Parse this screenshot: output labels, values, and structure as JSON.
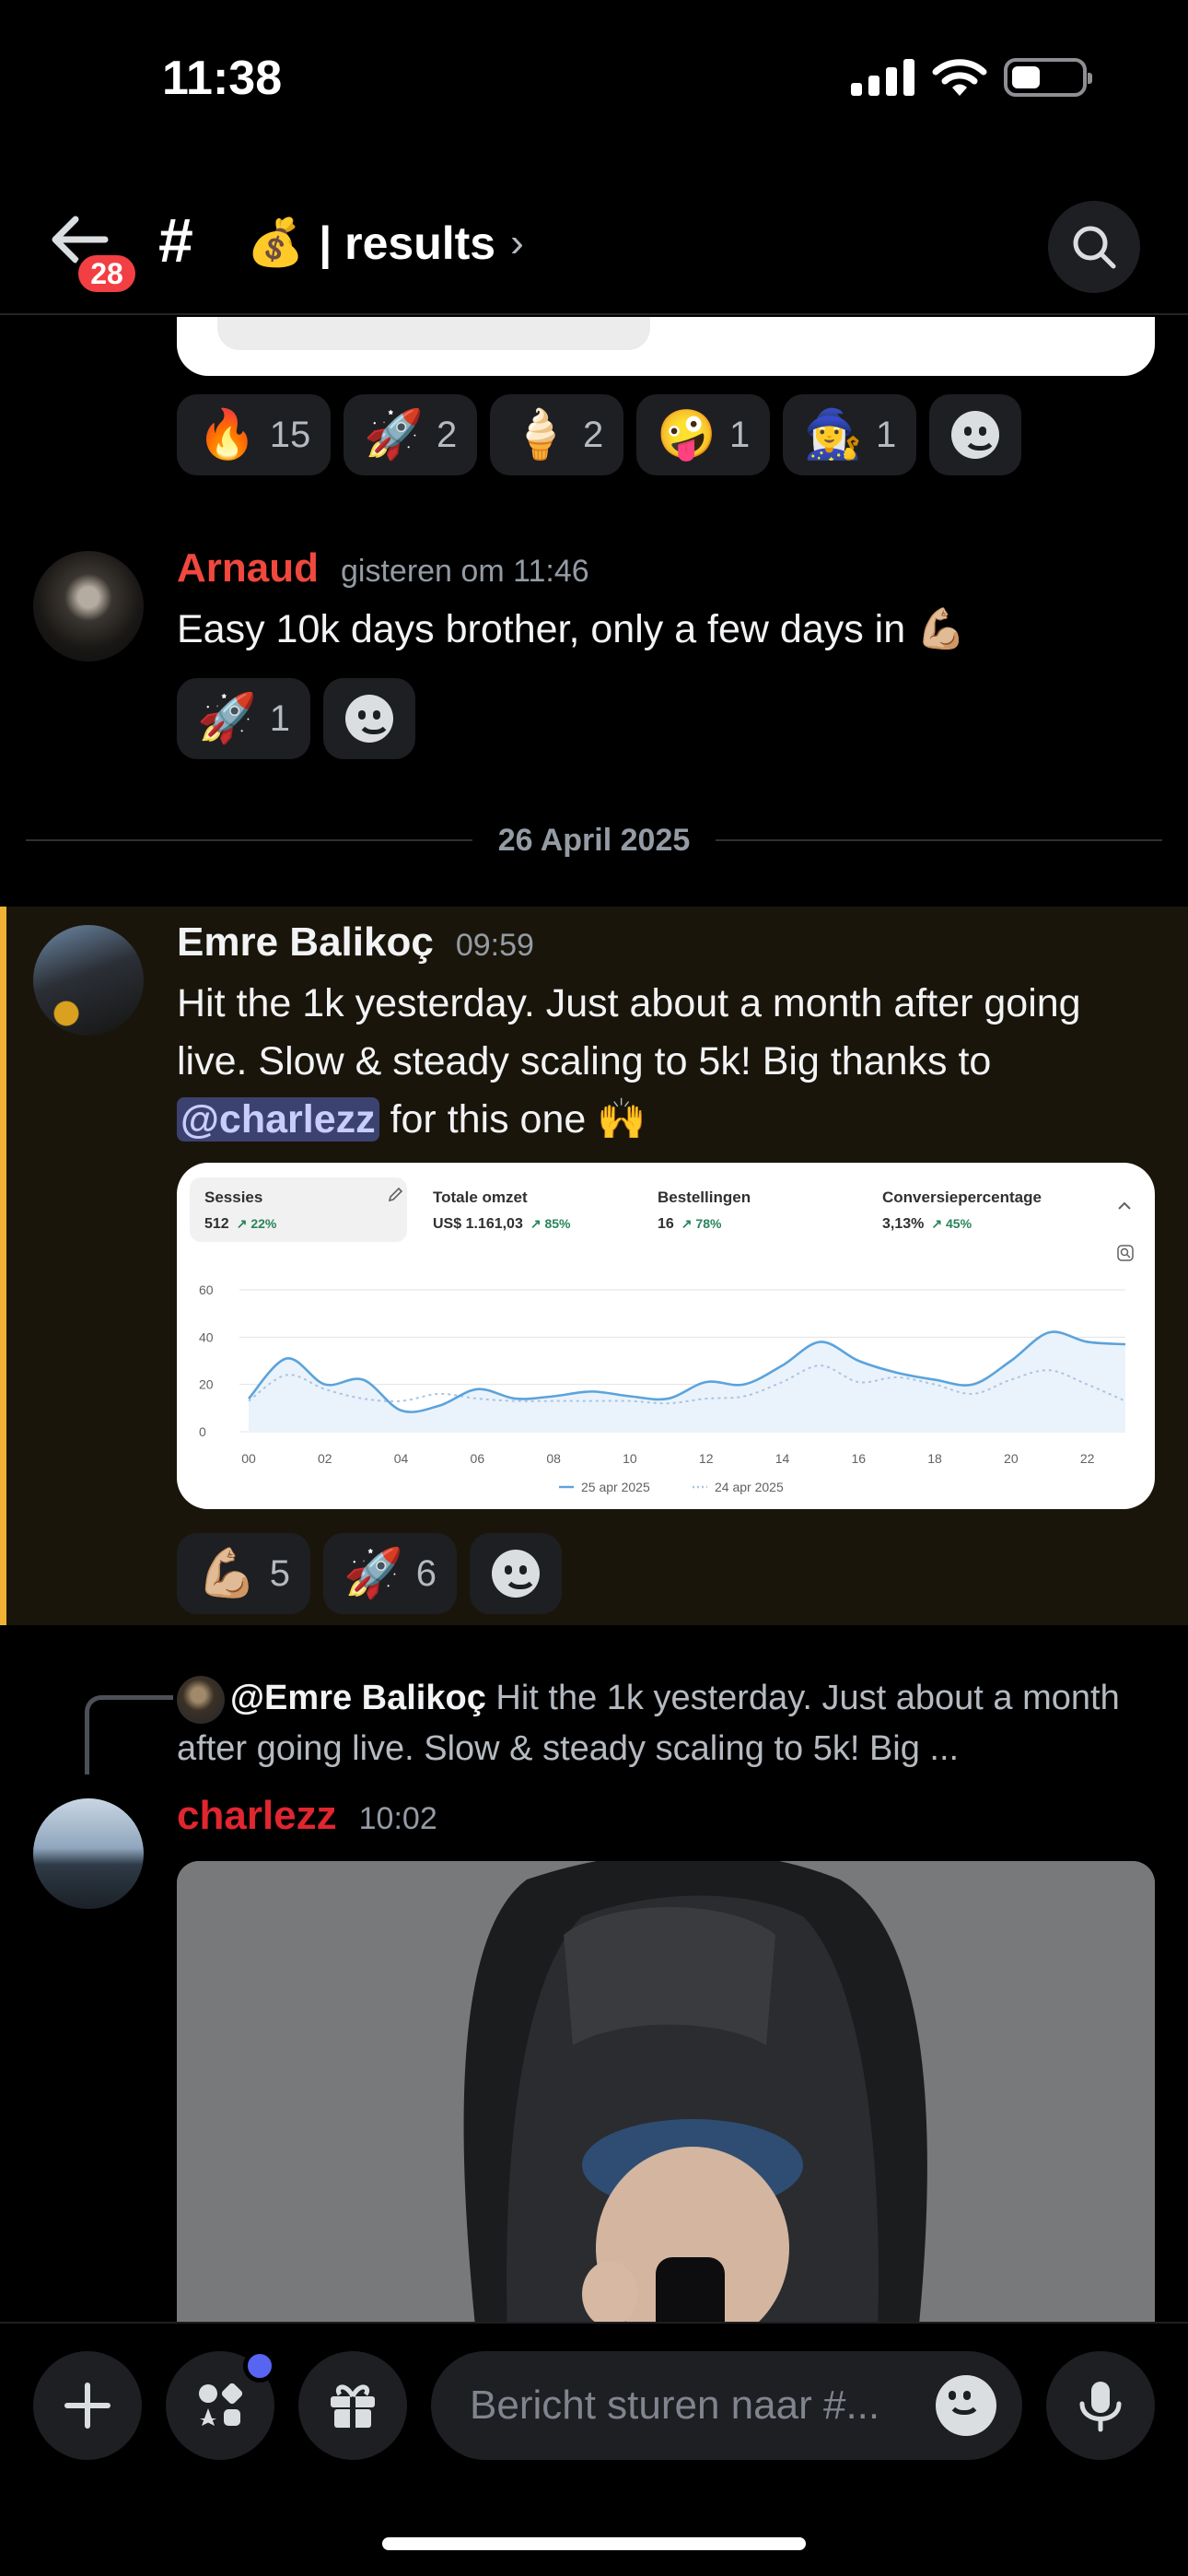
{
  "status_bar": {
    "time": "11:38"
  },
  "header": {
    "back_badge": "28",
    "hash": "#",
    "channel_emoji": "💰",
    "channel_name": "| results",
    "chevron": "›"
  },
  "messages": {
    "top_reactions": [
      {
        "emoji": "🔥",
        "count": "15"
      },
      {
        "emoji": "🚀",
        "count": "2"
      },
      {
        "emoji": "🍦",
        "count": "2"
      },
      {
        "emoji": "🤪",
        "count": "1"
      },
      {
        "emoji": "🧙‍♀️",
        "count": "1"
      }
    ],
    "arnaud": {
      "author": "Arnaud",
      "timestamp": "gisteren om 11:46",
      "text": "Easy 10k days brother, only a few days in 💪🏼",
      "reactions": [
        {
          "emoji": "🚀",
          "count": "1"
        }
      ]
    },
    "date_divider": "26 April 2025",
    "emre": {
      "author": "Emre Balikoç",
      "timestamp": "09:59",
      "text_before": "Hit the 1k yesterday. Just about a month after going live. Slow & steady scaling to 5k! Big thanks to ",
      "mention": "@charlezz",
      "text_after": "  for this one 🙌",
      "reactions": [
        {
          "emoji": "💪🏼",
          "count": "5"
        },
        {
          "emoji": "🚀",
          "count": "6"
        }
      ]
    },
    "reply": {
      "mention_name": "@Emre Balikoç",
      "preview": " Hit the 1k yesterday. Just about a month after going live. Slow & steady scaling to 5k! Big ..."
    },
    "charlezz": {
      "author": "charlezz",
      "timestamp": "10:02"
    }
  },
  "analytics": {
    "metrics": [
      {
        "label": "Sessies",
        "value": "512",
        "change": "↗ 22%"
      },
      {
        "label": "Totale omzet",
        "value": "US$ 1.161,03",
        "change": "↗ 85%"
      },
      {
        "label": "Bestellingen",
        "value": "16",
        "change": "↗ 78%"
      },
      {
        "label": "Conversiepercentage",
        "value": "3,13%",
        "change": "↗ 45%"
      }
    ]
  },
  "chart_data": {
    "type": "line",
    "x": [
      0,
      1,
      2,
      3,
      4,
      5,
      6,
      7,
      8,
      9,
      10,
      11,
      12,
      13,
      14,
      15,
      16,
      17,
      18,
      19,
      20,
      21,
      22,
      23
    ],
    "xtick_labels": [
      "00",
      "02",
      "04",
      "06",
      "08",
      "10",
      "12",
      "14",
      "16",
      "18",
      "20",
      "22"
    ],
    "ylim": [
      0,
      60
    ],
    "yticks": [
      "0",
      "20",
      "40",
      "60"
    ],
    "series": [
      {
        "name": "25 apr 2025",
        "values": [
          14,
          31,
          20,
          22,
          9,
          11,
          18,
          14,
          15,
          17,
          15,
          14,
          21,
          20,
          28,
          38,
          30,
          25,
          22,
          20,
          30,
          42,
          38,
          37
        ]
      },
      {
        "name": "24 apr 2025",
        "values": [
          13,
          24,
          18,
          14,
          13,
          16,
          14,
          13,
          13,
          13,
          13,
          12,
          14,
          15,
          21,
          28,
          21,
          23,
          20,
          16,
          22,
          26,
          20,
          13
        ]
      }
    ],
    "colors": [
      "#5ba3dc",
      "#aac4e2"
    ],
    "grid": true,
    "legend": "bottom"
  },
  "composer": {
    "placeholder": "Bericht sturen naar #..."
  }
}
